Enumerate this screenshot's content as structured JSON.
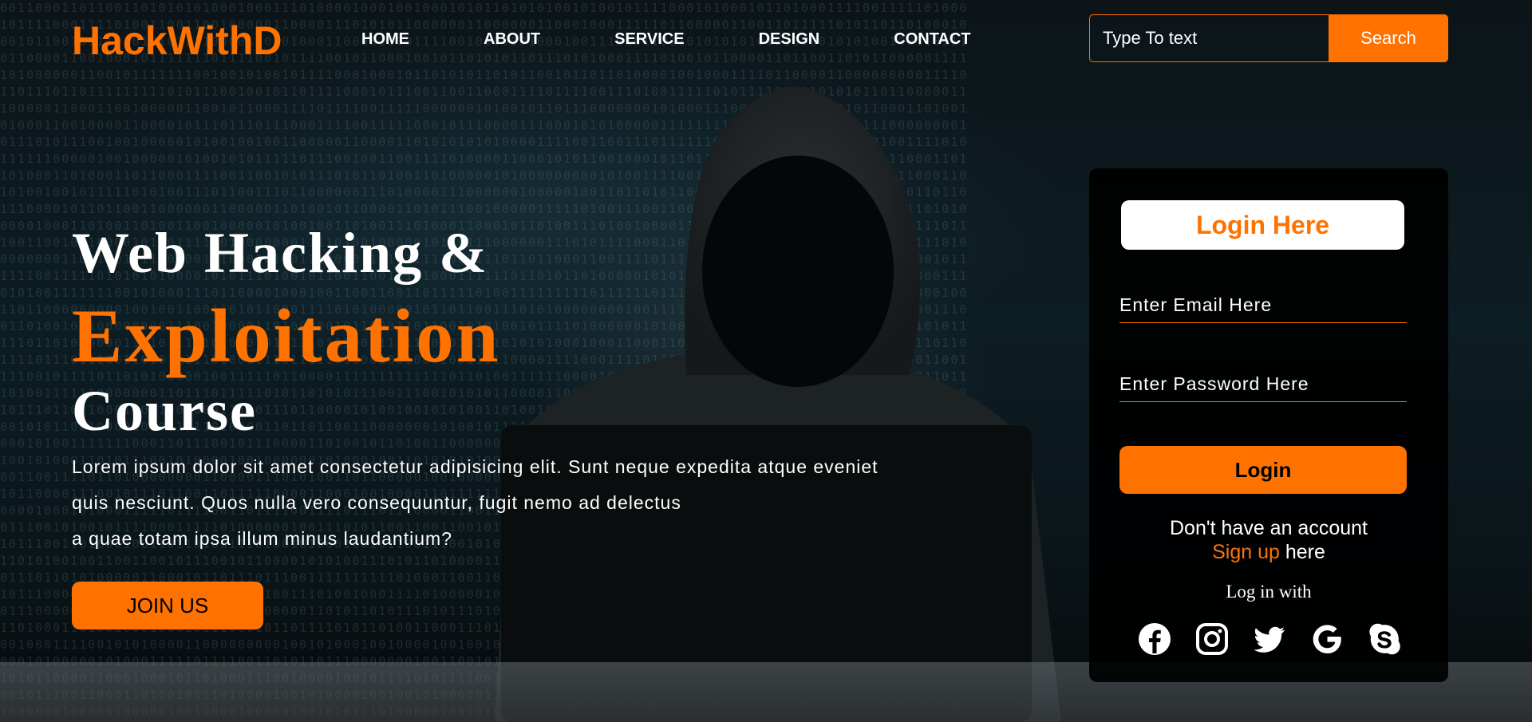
{
  "header": {
    "logo": "HackWithD",
    "nav": [
      "HOME",
      "ABOUT",
      "SERVICE",
      "DESIGN",
      "CONTACT"
    ],
    "search": {
      "placeholder": "Type To text",
      "button": "Search"
    }
  },
  "hero": {
    "line1": "Web Hacking &",
    "line2": "Exploitation",
    "line3": "Course",
    "paragraph_lines": [
      "Lorem ipsum dolor sit amet consectetur adipisicing elit. Sunt neque expedita atque eveniet",
      "quis nesciunt. Quos nulla vero consequuntur, fugit nemo ad delectus",
      "a quae totam ipsa illum minus laudantium?"
    ],
    "join_button": "JOIN US"
  },
  "login": {
    "title": "Login Here",
    "email_placeholder": "Enter Email Here",
    "password_placeholder": "Enter Password Here",
    "button": "Login",
    "no_account": "Don't have an account",
    "signup": "Sign up",
    "here": " here",
    "login_with": "Log in with",
    "social_icons": [
      "facebook-icon",
      "instagram-icon",
      "twitter-icon",
      "google-icon",
      "skype-icon"
    ]
  },
  "colors": {
    "accent": "#ff7200",
    "text": "#ffffff",
    "card_bg": "#000000"
  }
}
